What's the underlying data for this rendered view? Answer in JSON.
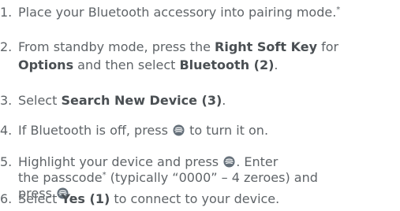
{
  "steps": [
    {
      "num": "1.",
      "pre": "Place your Bluetooth accessory into pairing mode.",
      "sup": "*"
    },
    {
      "num": "2.",
      "l1_pre": "From standby mode, press the ",
      "l1_bold": "Right Soft Key",
      "l1_post": " for",
      "l2_bold1": "Options",
      "l2_mid": " and then select ",
      "l2_bold2": "Bluetooth (2)",
      "l2_post": "."
    },
    {
      "num": "3.",
      "pre": "Select ",
      "bold": "Search New Device (3)",
      "post": "."
    },
    {
      "num": "4.",
      "pre": "If Bluetooth is off, press ",
      "icon": "ok-key-icon",
      "post": " to turn it on."
    },
    {
      "num": "5.",
      "l1_pre": "Highlight your device and press ",
      "l1_icon": "ok-key-icon",
      "l1_post": ". Enter",
      "l2_pre": "the passcode",
      "l2_sup": "*",
      "l2_post": " (typically “0000” – 4 zeroes) and",
      "l3_pre": "press ",
      "l3_icon": "ok-key-icon",
      "l3_post": "."
    },
    {
      "num": "6.",
      "pre": "Select ",
      "bold": "Yes (1)",
      "post": " to connect to your device."
    }
  ],
  "colors": {
    "text": "#5f6468",
    "bold": "#4a4f53",
    "icon_fill": "#65707a"
  }
}
